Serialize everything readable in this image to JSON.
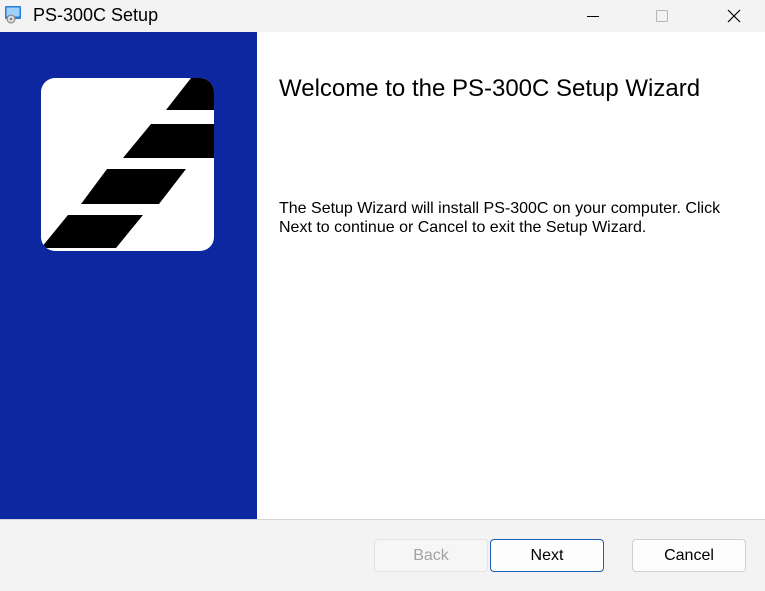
{
  "window": {
    "title": "PS-300C Setup",
    "icon": "installer-package-icon"
  },
  "titlebar": {
    "minimize_icon": "minimize-icon",
    "maximize_icon": "maximize-icon",
    "close_icon": "close-icon"
  },
  "banner": {
    "background_color": "#0c27a0",
    "logo_icon": "diagonal-stripes-logo-icon"
  },
  "content": {
    "heading": "Welcome to the PS-300C Setup Wizard",
    "description": "The Setup Wizard will install PS-300C on your computer. Click Next to continue or Cancel to exit the Setup Wizard."
  },
  "footer": {
    "back_label": "Back",
    "next_label": "Next",
    "cancel_label": "Cancel"
  }
}
